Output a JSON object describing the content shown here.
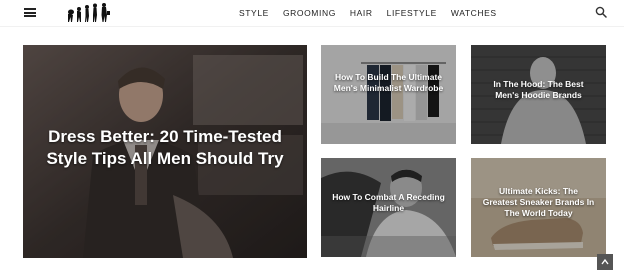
{
  "header": {
    "menu_icon": "hamburger-menu-icon",
    "logo_icon": "evolution-silhouette-logo",
    "nav": [
      {
        "label": "STYLE"
      },
      {
        "label": "GROOMING"
      },
      {
        "label": "HAIR"
      },
      {
        "label": "LIFESTYLE"
      },
      {
        "label": "WATCHES"
      }
    ],
    "search_icon": "search-icon"
  },
  "tiles": {
    "main": {
      "title": "Dress Better: 20 Time-Tested Style Tips All Men Should Try"
    },
    "wardrobe": {
      "title": "How To Build The Ultimate Men's Minimalist Wardrobe"
    },
    "hoodie": {
      "title": "In The Hood: The Best Men's Hoodie Brands"
    },
    "hairline": {
      "title": "How To Combat A Receding Hairline"
    },
    "sneakers": {
      "title": "Ultimate Kicks: The Greatest Sneaker Brands In The World Today"
    }
  },
  "scroll_top_icon": "chevron-up-icon",
  "colors": {
    "text": "#222222",
    "tile_text": "#ffffff",
    "scroll_button": "#555555"
  }
}
